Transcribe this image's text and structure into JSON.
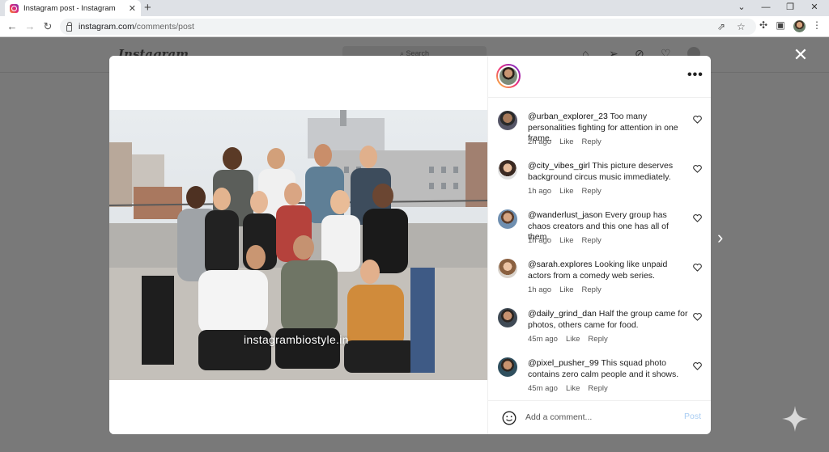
{
  "browser": {
    "tab_title": "Instagram post - Instagram",
    "tab_close": "✕",
    "new_tab": "+",
    "url_host": "instagram.com",
    "url_path": "/comments/post"
  },
  "background_page": {
    "logo": "Instagram",
    "search_placeholder": "⌕ Search"
  },
  "modal": {
    "watermark": "instagrambiostyle.in",
    "more_label": "•••",
    "comments": [
      {
        "user": "@urban_explorer_23",
        "text": "Too many personalities fighting for attention in one frame.",
        "time": "2h ago",
        "like": "Like",
        "reply": "Reply"
      },
      {
        "user": "@city_vibes_girl",
        "text": "This picture deserves background circus music immediately.",
        "time": "1h ago",
        "like": "Like",
        "reply": "Reply"
      },
      {
        "user": "@wanderlust_jason",
        "text": "Every group has chaos creators and this one has all of them.",
        "time": "1h ago",
        "like": "Like",
        "reply": "Reply"
      },
      {
        "user": "@sarah.explores",
        "text": "Looking like unpaid actors from a comedy web series.",
        "time": "1h ago",
        "like": "Like",
        "reply": "Reply"
      },
      {
        "user": "@daily_grind_dan",
        "text": "Half the group came for photos, others came for food.",
        "time": "45m ago",
        "like": "Like",
        "reply": "Reply"
      },
      {
        "user": "@pixel_pusher_99",
        "text": "This squad photo contains zero calm people and it shows.",
        "time": "45m ago",
        "like": "Like",
        "reply": "Reply"
      }
    ],
    "add_comment_placeholder": "Add a comment...",
    "post_label": "Post"
  },
  "colors": {
    "post_disabled": "#a9cdf3",
    "overlay": "#797979",
    "story_ring": [
      "#f9ce34",
      "#ee2a7b",
      "#6228d7"
    ]
  }
}
